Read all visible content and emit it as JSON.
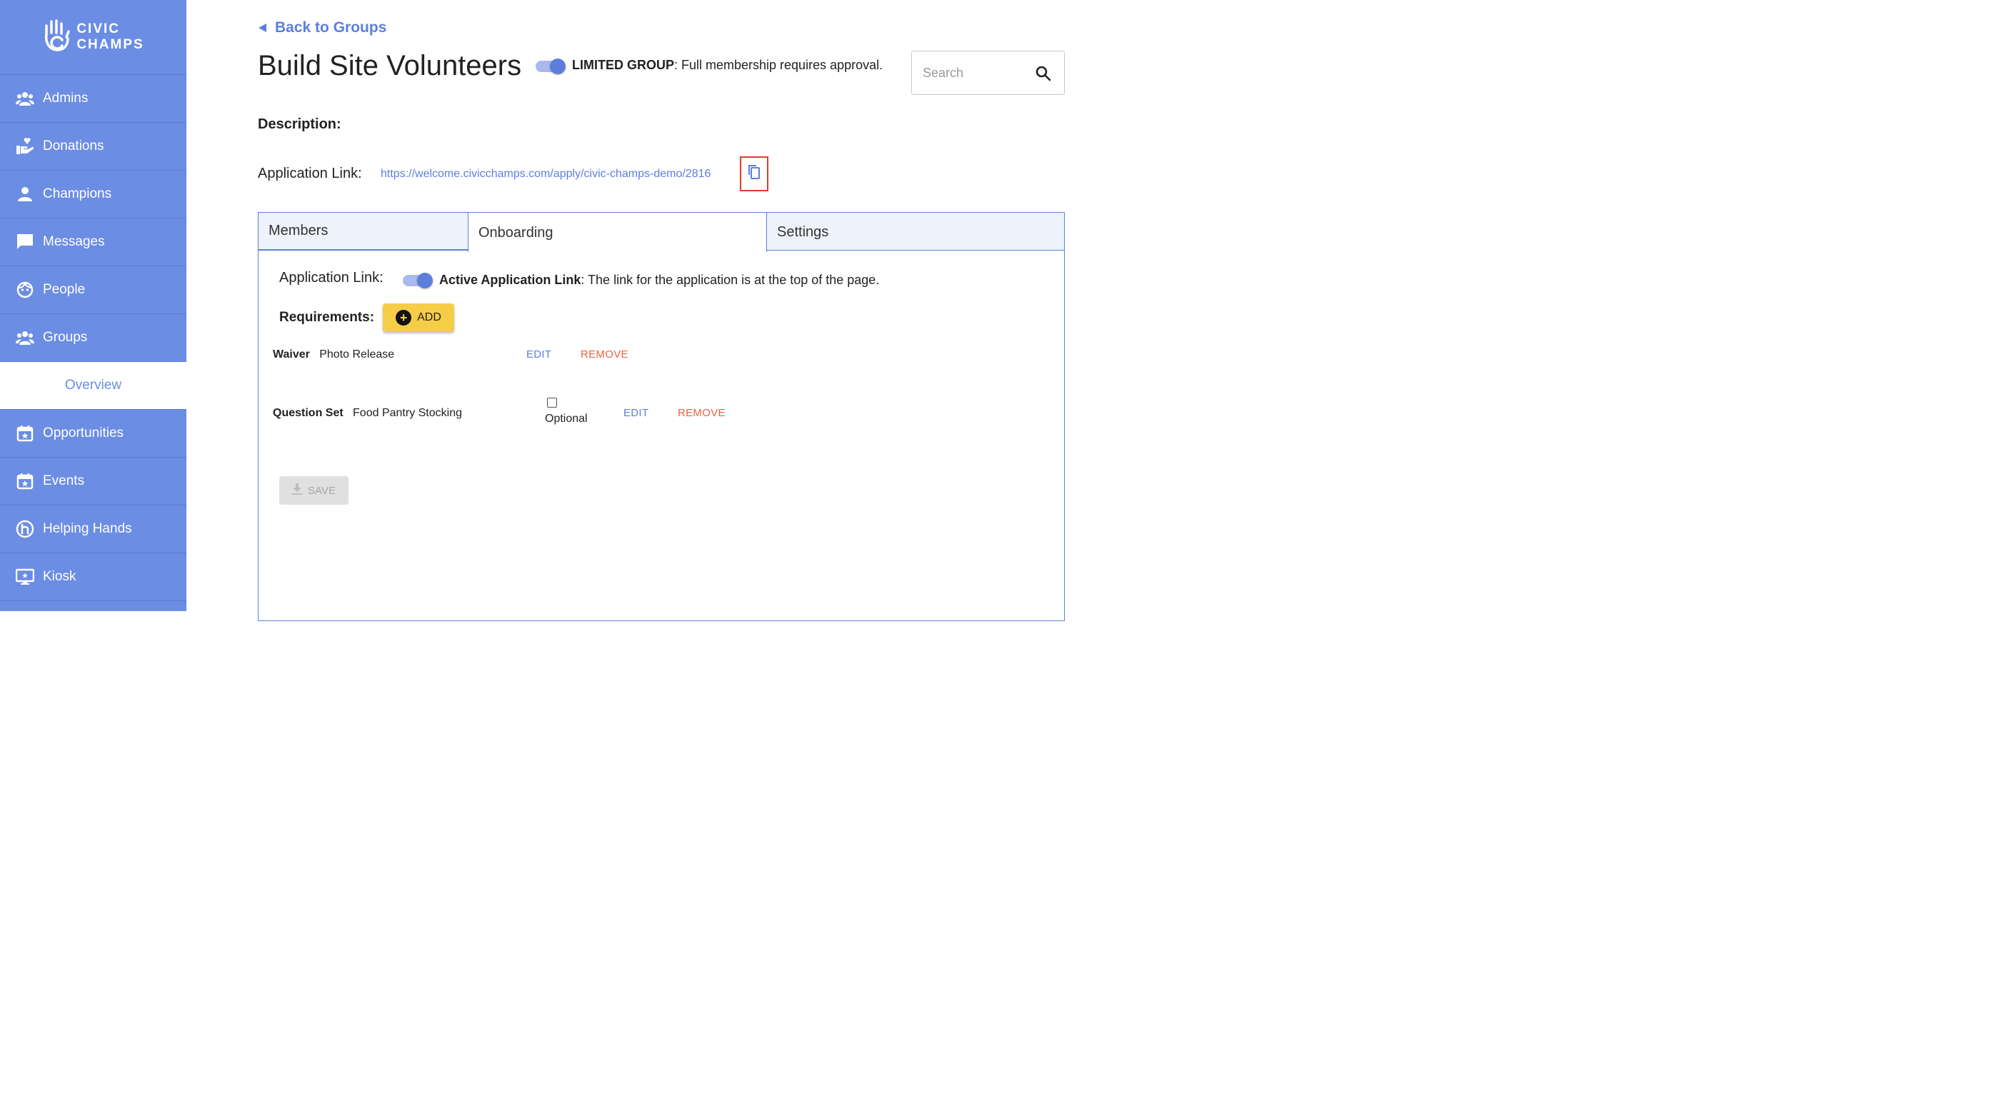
{
  "sidebar": {
    "logo_line1": "CIVIC",
    "logo_line2": "CHAMPS",
    "items": [
      {
        "label": "Admins",
        "icon": "people-group-icon"
      },
      {
        "label": "Donations",
        "icon": "hand-heart-icon"
      },
      {
        "label": "Champions",
        "icon": "person-icon"
      },
      {
        "label": "Messages",
        "icon": "chat-bubble-icon"
      },
      {
        "label": "People",
        "icon": "face-icon"
      },
      {
        "label": "Groups",
        "icon": "people-group-icon"
      },
      {
        "label": "Overview",
        "icon": ""
      },
      {
        "label": "Opportunities",
        "icon": "calendar-star-icon"
      },
      {
        "label": "Events",
        "icon": "calendar-star-icon"
      },
      {
        "label": "Helping Hands",
        "icon": "helping-hands-icon"
      },
      {
        "label": "Kiosk",
        "icon": "monitor-icon"
      }
    ]
  },
  "header": {
    "back_label": "Back to Groups",
    "title": "Build Site Volunteers",
    "limited_bold": "LIMITED GROUP",
    "limited_rest": ": Full membership requires approval.",
    "search_placeholder": "Search"
  },
  "details": {
    "description_label": "Description:",
    "app_link_label": "Application Link:",
    "app_link_url": "https://welcome.civicchamps.com/apply/civic-champs-demo/2816"
  },
  "tabs": [
    {
      "label": "Members"
    },
    {
      "label": "Onboarding"
    },
    {
      "label": "Settings"
    }
  ],
  "onboarding": {
    "app_link_label": "Application Link:",
    "active_bold": "Active Application Link",
    "active_rest": ": The link for the application is at the top of the page.",
    "requirements_label": "Requirements:",
    "add_label": "ADD",
    "requirements": [
      {
        "type": "Waiver",
        "name": "Photo Release",
        "edit": "EDIT",
        "remove": "REMOVE"
      },
      {
        "type": "Question Set",
        "name": "Food Pantry Stocking",
        "optional_label": "Optional",
        "optional_checked": false,
        "edit": "EDIT",
        "remove": "REMOVE"
      }
    ],
    "save_label": "SAVE"
  },
  "colors": {
    "sidebar": "#6b8de3",
    "accent": "#5d7fdc",
    "add_button": "#f5cd47",
    "remove": "#e8643e",
    "highlight_box": "#e53a2e"
  }
}
